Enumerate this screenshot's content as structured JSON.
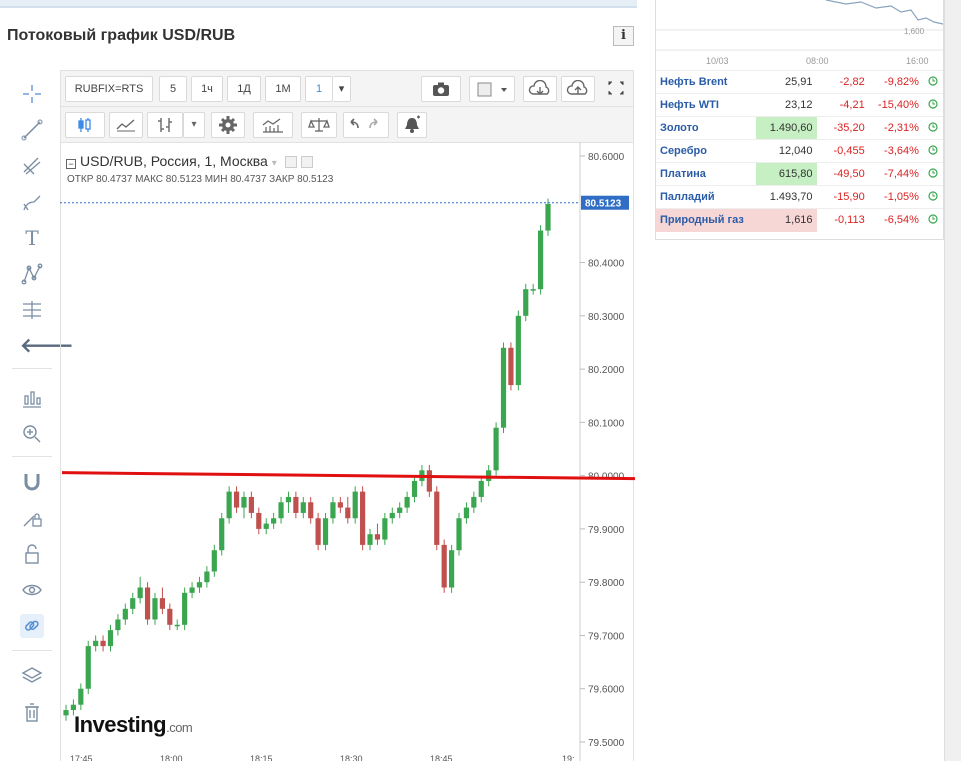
{
  "page": {
    "title": "Потоковый график USD/RUB",
    "info_label": "i"
  },
  "toolbar": {
    "symbol": "RUBFIX=RTS",
    "intervals": [
      "5",
      "1ч",
      "1Д",
      "1М",
      "1"
    ],
    "dropdown": "▾"
  },
  "legend": {
    "title": "USD/RUB, Россия, 1, Москва",
    "ohlc": "ОТКР 80.4737  МАКС 80.5123  МИН 80.4737  ЗАКР 80.5123"
  },
  "logo": {
    "main": "Investing",
    "suffix": ".com"
  },
  "chart_data": {
    "type": "candlestick",
    "title": "USD/RUB, Россия, 1, Москва",
    "y_ticks": [
      "80.6000",
      "80.4000",
      "80.3000",
      "80.2000",
      "80.1000",
      "80.0000",
      "79.9000",
      "79.8000",
      "79.7000",
      "79.6000",
      "79.5000"
    ],
    "x_ticks": [
      "17:45",
      "18:00",
      "18:15",
      "18:30",
      "18:45",
      "19:"
    ],
    "ylim": [
      79.5,
      80.6
    ],
    "current_price": "80.5123",
    "resistance_line": 80.0,
    "colors": {
      "up": "#3aa64f",
      "down": "#c0504d",
      "line": "#e01010",
      "price_tag": "#2f6ec4"
    },
    "candles": [
      [
        79.55,
        79.57,
        79.54,
        79.56
      ],
      [
        79.56,
        79.58,
        79.55,
        79.57
      ],
      [
        79.57,
        79.61,
        79.56,
        79.6
      ],
      [
        79.6,
        79.69,
        79.59,
        79.68
      ],
      [
        79.68,
        79.7,
        79.67,
        79.69
      ],
      [
        79.69,
        79.7,
        79.67,
        79.68
      ],
      [
        79.68,
        79.72,
        79.67,
        79.71
      ],
      [
        79.71,
        79.74,
        79.7,
        79.73
      ],
      [
        79.73,
        79.76,
        79.72,
        79.75
      ],
      [
        79.75,
        79.78,
        79.74,
        79.77
      ],
      [
        79.77,
        79.81,
        79.76,
        79.79
      ],
      [
        79.79,
        79.8,
        79.72,
        79.73
      ],
      [
        79.73,
        79.78,
        79.72,
        79.77
      ],
      [
        79.77,
        79.79,
        79.74,
        79.75
      ],
      [
        79.75,
        79.76,
        79.71,
        79.72
      ],
      [
        79.72,
        79.73,
        79.71,
        79.72
      ],
      [
        79.72,
        79.79,
        79.71,
        79.78
      ],
      [
        79.78,
        79.8,
        79.77,
        79.79
      ],
      [
        79.79,
        79.81,
        79.78,
        79.8
      ],
      [
        79.8,
        79.83,
        79.79,
        79.82
      ],
      [
        79.82,
        79.87,
        79.81,
        79.86
      ],
      [
        79.86,
        79.93,
        79.85,
        79.92
      ],
      [
        79.92,
        79.98,
        79.91,
        79.97
      ],
      [
        79.97,
        79.98,
        79.93,
        79.94
      ],
      [
        79.94,
        79.97,
        79.92,
        79.96
      ],
      [
        79.96,
        79.97,
        79.92,
        79.93
      ],
      [
        79.93,
        79.94,
        79.89,
        79.9
      ],
      [
        79.9,
        79.92,
        79.89,
        79.91
      ],
      [
        79.91,
        79.93,
        79.9,
        79.92
      ],
      [
        79.92,
        79.96,
        79.91,
        79.95
      ],
      [
        79.95,
        79.97,
        79.93,
        79.96
      ],
      [
        79.96,
        79.97,
        79.92,
        79.93
      ],
      [
        79.93,
        79.96,
        79.92,
        79.95
      ],
      [
        79.95,
        79.96,
        79.91,
        79.92
      ],
      [
        79.92,
        79.93,
        79.86,
        79.87
      ],
      [
        79.87,
        79.93,
        79.86,
        79.92
      ],
      [
        79.92,
        79.96,
        79.91,
        79.95
      ],
      [
        79.95,
        79.96,
        79.93,
        79.94
      ],
      [
        79.94,
        79.96,
        79.91,
        79.92
      ],
      [
        79.92,
        79.98,
        79.91,
        79.97
      ],
      [
        79.97,
        79.98,
        79.86,
        79.87
      ],
      [
        79.87,
        79.9,
        79.86,
        79.89
      ],
      [
        79.89,
        79.91,
        79.87,
        79.88
      ],
      [
        79.88,
        79.93,
        79.87,
        79.92
      ],
      [
        79.92,
        79.94,
        79.91,
        79.93
      ],
      [
        79.93,
        79.95,
        79.92,
        79.94
      ],
      [
        79.94,
        79.97,
        79.93,
        79.96
      ],
      [
        79.96,
        80.0,
        79.95,
        79.99
      ],
      [
        79.99,
        80.02,
        79.98,
        80.01
      ],
      [
        80.01,
        80.02,
        79.96,
        79.97
      ],
      [
        79.97,
        79.98,
        79.86,
        79.87
      ],
      [
        79.87,
        79.88,
        79.78,
        79.79
      ],
      [
        79.79,
        79.87,
        79.78,
        79.86
      ],
      [
        79.86,
        79.93,
        79.85,
        79.92
      ],
      [
        79.92,
        79.95,
        79.91,
        79.94
      ],
      [
        79.94,
        79.97,
        79.93,
        79.96
      ],
      [
        79.96,
        80.0,
        79.95,
        79.99
      ],
      [
        79.99,
        80.02,
        79.98,
        80.01
      ],
      [
        80.01,
        80.1,
        80.0,
        80.09
      ],
      [
        80.09,
        80.25,
        80.08,
        80.24
      ],
      [
        80.24,
        80.25,
        80.16,
        80.17
      ],
      [
        80.17,
        80.31,
        80.16,
        80.3
      ],
      [
        80.3,
        80.36,
        80.29,
        80.35
      ],
      [
        80.35,
        80.36,
        80.34,
        80.35
      ],
      [
        80.35,
        80.47,
        80.34,
        80.46
      ],
      [
        80.46,
        80.52,
        80.45,
        80.51
      ]
    ]
  },
  "quotes": {
    "mini_axis": [
      "10/03",
      "08:00",
      "16:00"
    ],
    "mini_value": "1,600",
    "rows": [
      {
        "name": "Нефть Brent",
        "last": "25,91",
        "chg": "-2,82",
        "pct": "-9,82%",
        "hl": ""
      },
      {
        "name": "Нефть WTI",
        "last": "23,12",
        "chg": "-4,21",
        "pct": "-15,40%",
        "hl": ""
      },
      {
        "name": "Золото",
        "last": "1.490,60",
        "chg": "-35,20",
        "pct": "-2,31%",
        "hl": "green"
      },
      {
        "name": "Серебро",
        "last": "12,040",
        "chg": "-0,455",
        "pct": "-3,64%",
        "hl": ""
      },
      {
        "name": "Платина",
        "last": "615,80",
        "chg": "-49,50",
        "pct": "-7,44%",
        "hl": "green"
      },
      {
        "name": "Палладий",
        "last": "1.493,70",
        "chg": "-15,90",
        "pct": "-1,05%",
        "hl": ""
      },
      {
        "name": "Природный газ",
        "last": "1,616",
        "chg": "-0,113",
        "pct": "-6,54%",
        "hl": "red"
      }
    ]
  }
}
